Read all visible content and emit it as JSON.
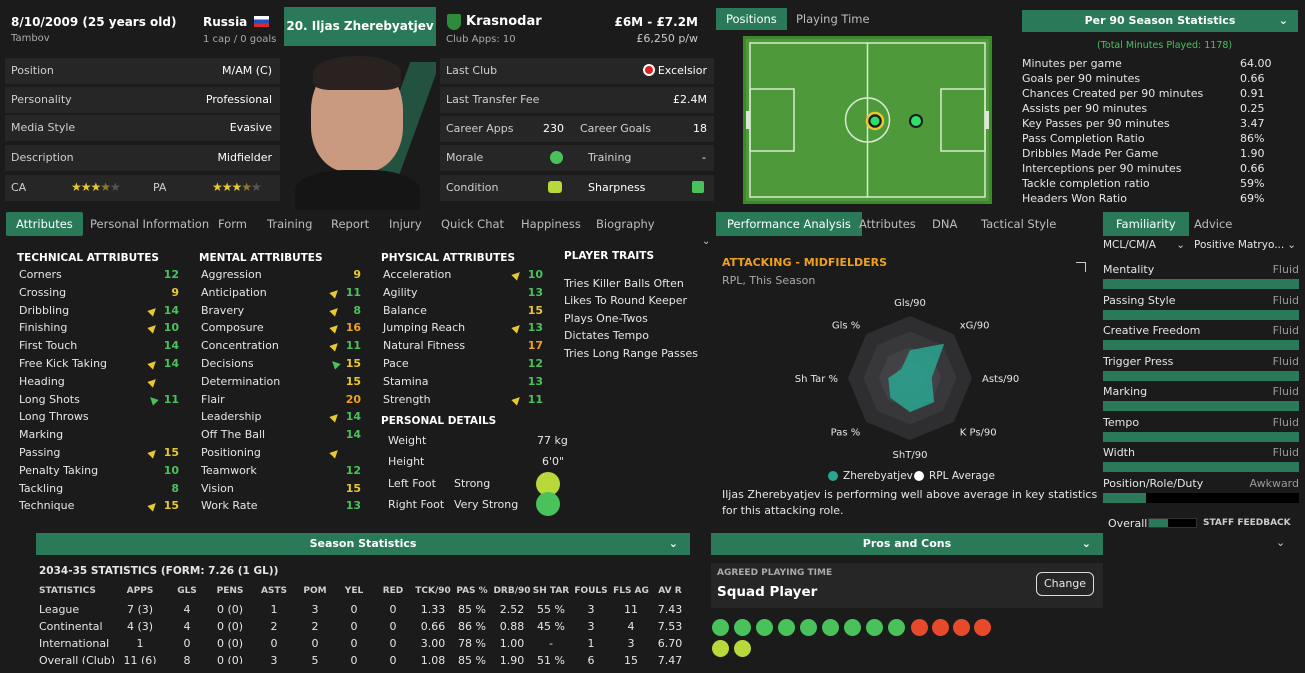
{
  "header": {
    "dob": "8/10/2009 (25 years old)",
    "hometown": "Tambov",
    "nation": "Russia",
    "caps": "1 cap / 0 goals",
    "player_button": "20. Iljas Zherebyatjev",
    "club": "Krasnodar",
    "club_apps": "Club Apps: 10",
    "value": "£6M - £7.2M",
    "wage": "£6,250 p/w"
  },
  "info_rows": [
    {
      "k": "Position",
      "v": "M/AM (C)"
    },
    {
      "k": "Personality",
      "v": "Professional"
    },
    {
      "k": "Media Style",
      "v": "Evasive"
    },
    {
      "k": "Description",
      "v": "Midfielder"
    }
  ],
  "ratings": {
    "ca_label": "CA",
    "pa_label": "PA",
    "ca_stars": 3.5,
    "pa_stars": 3.5
  },
  "career": {
    "last_club_label": "Last Club",
    "last_club": "Excelsior",
    "last_fee_label": "Last Transfer Fee",
    "last_fee": "£2.4M",
    "apps_label": "Career Apps",
    "apps": "230",
    "goals_label": "Career Goals",
    "goals": "18",
    "morale_label": "Morale",
    "training_label": "Training",
    "training": "-",
    "condition_label": "Condition",
    "sharpness_label": "Sharpness"
  },
  "left_tabs": [
    "Attributes",
    "Personal Information",
    "Form",
    "Training",
    "Report",
    "Injury",
    "Quick Chat",
    "Happiness",
    "Biography"
  ],
  "attributes": {
    "technical_title": "TECHNICAL ATTRIBUTES",
    "technical": [
      {
        "n": "Corners",
        "v": "12",
        "c": "g",
        "arr": ""
      },
      {
        "n": "Crossing",
        "v": "9",
        "c": "y",
        "arr": ""
      },
      {
        "n": "Dribbling",
        "v": "14",
        "c": "g",
        "arr": "y"
      },
      {
        "n": "Finishing",
        "v": "10",
        "c": "g",
        "arr": "y"
      },
      {
        "n": "First Touch",
        "v": "14",
        "c": "g",
        "arr": ""
      },
      {
        "n": "Free Kick Taking",
        "v": "14",
        "c": "g",
        "arr": "y"
      },
      {
        "n": "Heading",
        "v": "",
        "c": "g",
        "arr": "y"
      },
      {
        "n": "Long Shots",
        "v": "11",
        "c": "g",
        "arr": "g"
      },
      {
        "n": "Long Throws",
        "v": "",
        "c": "g",
        "arr": ""
      },
      {
        "n": "Marking",
        "v": "",
        "c": "g",
        "arr": ""
      },
      {
        "n": "Passing",
        "v": "15",
        "c": "y",
        "arr": "y"
      },
      {
        "n": "Penalty Taking",
        "v": "10",
        "c": "g",
        "arr": ""
      },
      {
        "n": "Tackling",
        "v": "8",
        "c": "g",
        "arr": ""
      },
      {
        "n": "Technique",
        "v": "15",
        "c": "y",
        "arr": "y"
      }
    ],
    "mental_title": "MENTAL ATTRIBUTES",
    "mental": [
      {
        "n": "Aggression",
        "v": "9",
        "c": "y",
        "arr": ""
      },
      {
        "n": "Anticipation",
        "v": "11",
        "c": "g",
        "arr": "y"
      },
      {
        "n": "Bravery",
        "v": "8",
        "c": "g",
        "arr": "y"
      },
      {
        "n": "Composure",
        "v": "16",
        "c": "o",
        "arr": "y"
      },
      {
        "n": "Concentration",
        "v": "11",
        "c": "g",
        "arr": "y"
      },
      {
        "n": "Decisions",
        "v": "15",
        "c": "y",
        "arr": "g"
      },
      {
        "n": "Determination",
        "v": "15",
        "c": "y",
        "arr": ""
      },
      {
        "n": "Flair",
        "v": "20",
        "c": "o",
        "arr": ""
      },
      {
        "n": "Leadership",
        "v": "14",
        "c": "g",
        "arr": "y"
      },
      {
        "n": "Off The Ball",
        "v": "14",
        "c": "g",
        "arr": ""
      },
      {
        "n": "Positioning",
        "v": "",
        "c": "g",
        "arr": "y"
      },
      {
        "n": "Teamwork",
        "v": "12",
        "c": "g",
        "arr": ""
      },
      {
        "n": "Vision",
        "v": "15",
        "c": "y",
        "arr": ""
      },
      {
        "n": "Work Rate",
        "v": "13",
        "c": "g",
        "arr": ""
      }
    ],
    "physical_title": "PHYSICAL ATTRIBUTES",
    "physical": [
      {
        "n": "Acceleration",
        "v": "10",
        "c": "g",
        "arr": "y"
      },
      {
        "n": "Agility",
        "v": "13",
        "c": "g",
        "arr": ""
      },
      {
        "n": "Balance",
        "v": "15",
        "c": "y",
        "arr": ""
      },
      {
        "n": "Jumping Reach",
        "v": "13",
        "c": "g",
        "arr": "y"
      },
      {
        "n": "Natural Fitness",
        "v": "17",
        "c": "o",
        "arr": ""
      },
      {
        "n": "Pace",
        "v": "12",
        "c": "g",
        "arr": ""
      },
      {
        "n": "Stamina",
        "v": "13",
        "c": "g",
        "arr": ""
      },
      {
        "n": "Strength",
        "v": "11",
        "c": "g",
        "arr": "y"
      }
    ],
    "personal_title": "PERSONAL DETAILS",
    "weight_label": "Weight",
    "weight": "77 kg",
    "height_label": "Height",
    "height": "6'0\"",
    "left_foot_label": "Left Foot",
    "left_foot": "Strong",
    "right_foot_label": "Right Foot",
    "right_foot": "Very Strong",
    "traits_title": "PLAYER TRAITS",
    "traits": [
      "Tries Killer Balls Often",
      "Likes To Round Keeper",
      "Plays One-Twos",
      "Dictates Tempo",
      "Tries Long Range Passes"
    ]
  },
  "positions": {
    "tab_positions": "Positions",
    "tab_playing_time": "Playing Time"
  },
  "per90": {
    "title": "Per 90 Season Statistics",
    "subtitle": "(Total Minutes Played: 1178)",
    "rows": [
      {
        "k": "Minutes per game",
        "v": "64.00"
      },
      {
        "k": "Goals per 90 minutes",
        "v": "0.66"
      },
      {
        "k": "Chances Created per 90 minutes",
        "v": "0.91"
      },
      {
        "k": "Assists per 90 minutes",
        "v": "0.25"
      },
      {
        "k": "Key Passes per 90 minutes",
        "v": "3.47"
      },
      {
        "k": "Pass Completion Ratio",
        "v": "86%"
      },
      {
        "k": "Dribbles Made Per Game",
        "v": "1.90"
      },
      {
        "k": "Interceptions per 90 minutes",
        "v": "0.66"
      },
      {
        "k": "Tackle completion ratio",
        "v": "59%"
      },
      {
        "k": "Headers Won Ratio",
        "v": "69%"
      }
    ]
  },
  "mid_tabs": [
    "Performance Analysis",
    "Attributes",
    "DNA",
    "Tactical Style"
  ],
  "analysis": {
    "title": "ATTACKING - MIDFIELDERS",
    "subtitle": "RPL, This Season",
    "axes": [
      "Gls/90",
      "xG/90",
      "Asts/90",
      "K Ps/90",
      "ShT/90",
      "Pas %",
      "Sh Tar %",
      "Gls %"
    ],
    "player_values": [
      0.45,
      0.78,
      0.35,
      0.55,
      0.55,
      0.45,
      0.35,
      0.2
    ],
    "legend_player": "Zherebyatjev",
    "legend_avg": "RPL Average",
    "summary": "Iljas Zherebyatjev is performing well above average in key statistics for this attacking role."
  },
  "right_tabs": [
    "Familiarity",
    "Advice"
  ],
  "tactics": {
    "role_select": "MCL/CM/A",
    "mentality_select": "Positive Matryo...",
    "rows": [
      {
        "k": "Mentality",
        "v": "Fluid"
      },
      {
        "k": "Passing Style",
        "v": "Fluid"
      },
      {
        "k": "Creative Freedom",
        "v": "Fluid"
      },
      {
        "k": "Trigger Press",
        "v": "Fluid"
      },
      {
        "k": "Marking",
        "v": "Fluid"
      },
      {
        "k": "Tempo",
        "v": "Fluid"
      },
      {
        "k": "Width",
        "v": "Fluid"
      },
      {
        "k": "Position/Role/Duty",
        "v": "Awkward"
      }
    ],
    "overall_label": "Overall",
    "staff_feedback": "STAFF FEEDBACK"
  },
  "season_stats": {
    "title": "Season Statistics",
    "heading": "2034-35 STATISTICS (FORM: 7.26 (1 GL))",
    "columns": [
      "STATISTICS",
      "APPS",
      "GLS",
      "PENS",
      "ASTS",
      "POM",
      "YEL",
      "RED",
      "TCK/90",
      "PAS %",
      "DRB/90",
      "SH TAR",
      "FOULS",
      "FLS AG",
      "AV R"
    ],
    "rows": [
      [
        "League",
        "7 (3)",
        "4",
        "0 (0)",
        "1",
        "3",
        "0",
        "0",
        "1.33",
        "85 %",
        "2.52",
        "55 %",
        "3",
        "11",
        "7.43"
      ],
      [
        "Continental",
        "4 (3)",
        "4",
        "0 (0)",
        "2",
        "2",
        "0",
        "0",
        "0.66",
        "86 %",
        "0.88",
        "45 %",
        "3",
        "4",
        "7.53"
      ],
      [
        "International",
        "1",
        "0",
        "0 (0)",
        "0",
        "0",
        "0",
        "0",
        "3.00",
        "78 %",
        "1.00",
        "-",
        "1",
        "3",
        "6.70"
      ],
      [
        "Overall (Club)",
        "11 (6)",
        "8",
        "0 (0)",
        "3",
        "5",
        "0",
        "0",
        "1.08",
        "85 %",
        "1.90",
        "51 %",
        "6",
        "15",
        "7.47"
      ]
    ]
  },
  "pros_cons": {
    "title": "Pros and Cons",
    "agreed_label": "AGREED PLAYING TIME",
    "agreed_value": "Squad Player",
    "change_button": "Change"
  }
}
